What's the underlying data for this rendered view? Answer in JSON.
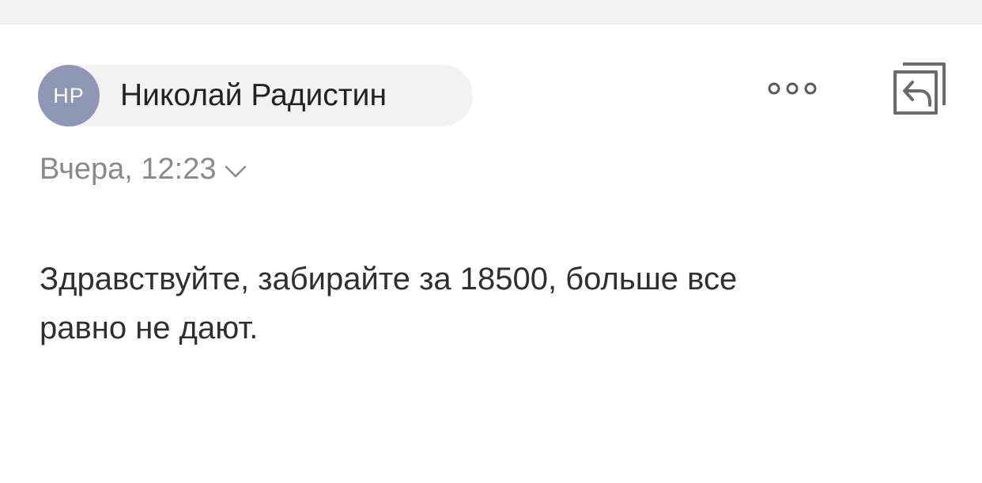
{
  "header": {
    "sender": {
      "initials": "HP",
      "name": "Николай Радистин",
      "avatar_color": "#8e97b3"
    },
    "actions": {
      "more_icon": "more-icon",
      "reply_icon": "reply-icon"
    },
    "date": "Вчера, 12:23"
  },
  "message": {
    "lines": [
      "Здравствуйте, забирайте за 18500, больше все",
      "равно не дают."
    ]
  }
}
